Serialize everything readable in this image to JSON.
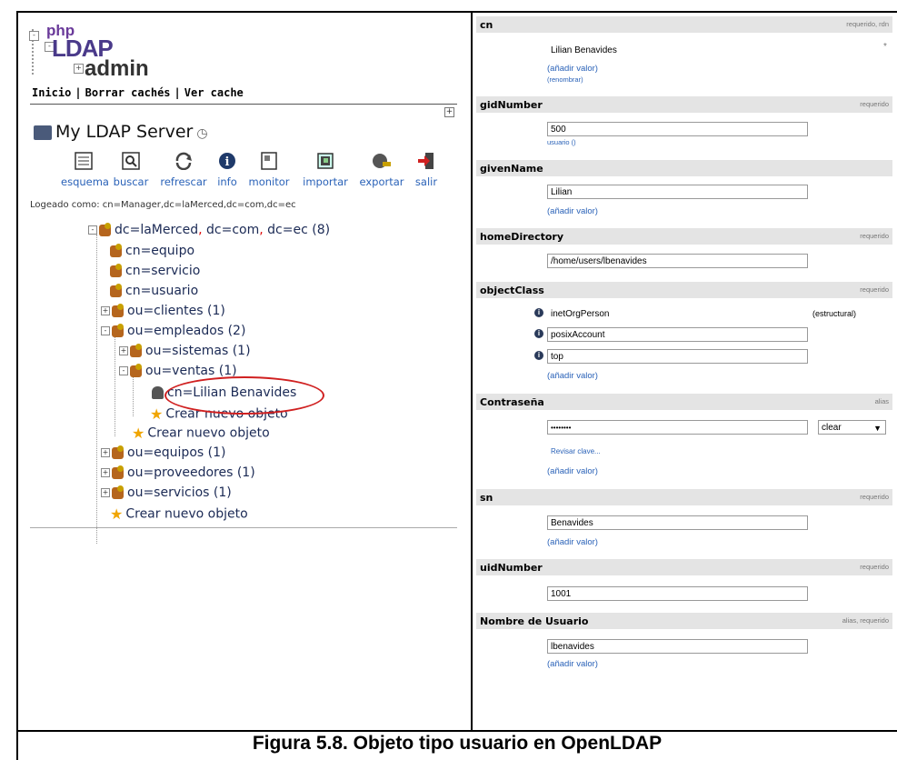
{
  "logo": {
    "php": "php",
    "ldap": "LDAP",
    "admin": "admin"
  },
  "toplinks": {
    "home": "Inicio",
    "purge": "Borrar cachés",
    "show_cache": "Ver cache",
    "sep": "|"
  },
  "server": {
    "name": "My LDAP Server",
    "clock_icon": "clock-icon"
  },
  "toolbar": [
    {
      "label": "esquema",
      "icon": "schema-icon"
    },
    {
      "label": "buscar",
      "icon": "search-icon"
    },
    {
      "label": "refrescar",
      "icon": "refresh-icon"
    },
    {
      "label": "info",
      "icon": "info-icon"
    },
    {
      "label": "monitor",
      "icon": "monitor-icon"
    },
    {
      "label": "importar",
      "icon": "import-icon"
    },
    {
      "label": "exportar",
      "icon": "export-icon"
    },
    {
      "label": "salir",
      "icon": "logout-icon"
    }
  ],
  "logged_as": "Logeado como: cn=Manager,dc=laMerced,dc=com,dc=ec",
  "tree": {
    "root": {
      "dc1": "dc=laMerced",
      "dc2": "dc=com",
      "dc3": "dc=ec",
      "count": "(8)",
      "comma": ","
    },
    "items": {
      "equipo": "cn=equipo",
      "servicio": "cn=servicio",
      "usuario": "cn=usuario",
      "clientes": "ou=clientes (1)",
      "empleados": "ou=empleados (2)",
      "sistemas": "ou=sistemas (1)",
      "ventas": "ou=ventas (1)",
      "lilian": "cn=Lilian Benavides",
      "create1": "Crear nuevo objeto",
      "create2": "Crear nuevo objeto",
      "equipos": "ou=equipos (1)",
      "proveedores": "ou=proveedores (1)",
      "servicios": "ou=servicios (1)",
      "create3": "Crear nuevo objeto"
    }
  },
  "attributes": {
    "cn": {
      "name": "cn",
      "req": "requerido, rdn",
      "value": "Lilian Benavides",
      "star": "*",
      "add": "(añadir valor)",
      "rename": "(renombrar)"
    },
    "gid": {
      "name": "gidNumber",
      "req": "requerido",
      "value": "500",
      "hint": "usuario ()"
    },
    "given": {
      "name": "givenName",
      "value": "Lilian",
      "add": "(añadir valor)"
    },
    "home": {
      "name": "homeDirectory",
      "req": "requerido",
      "value": "/home/users/lbenavides"
    },
    "oc": {
      "name": "objectClass",
      "req": "requerido",
      "v1": "inetOrgPerson",
      "struct": "(estructural)",
      "v2": "posixAccount",
      "v3": "top",
      "add": "(añadir valor)"
    },
    "pwd": {
      "name": "Contraseña",
      "req": "alias",
      "value": "••••••••",
      "hash": "clear",
      "arrow": "▼",
      "check": "Revisar clave...",
      "add": "(añadir valor)"
    },
    "sn": {
      "name": "sn",
      "req": "requerido",
      "value": "Benavides",
      "add": "(añadir valor)"
    },
    "uid": {
      "name": "uidNumber",
      "req": "requerido",
      "value": "1001"
    },
    "user": {
      "name": "Nombre de Usuario",
      "req": "alias, requerido",
      "value": "lbenavides",
      "add": "(añadir valor)"
    }
  },
  "caption": "Figura 5.8. Objeto tipo usuario en OpenLDAP"
}
